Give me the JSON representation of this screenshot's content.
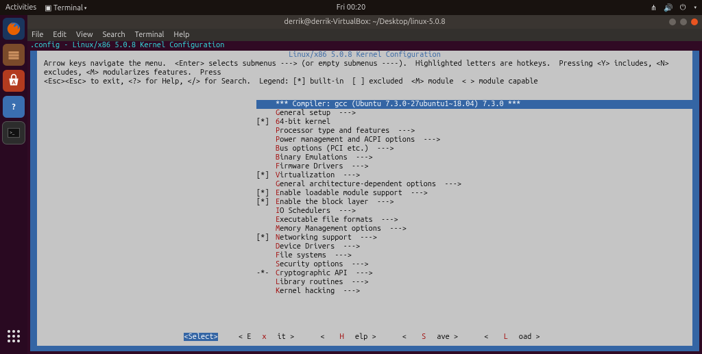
{
  "topbar": {
    "activities": "Activities",
    "app": "Terminal",
    "clock": "Fri 00:20"
  },
  "window": {
    "title": "derrik@derrik-VirtualBox: ~/Desktop/linux-5.0.8",
    "menubar": [
      "File",
      "Edit",
      "View",
      "Search",
      "Terminal",
      "Help"
    ]
  },
  "config_header": ".config - Linux/x86 5.0.8 Kernel Configuration",
  "box_title": "Linux/x86 5.0.8 Kernel Configuration",
  "help_line1": "Arrow keys navigate the menu.  <Enter> selects submenus ---> (or empty submenus ----).  Highlighted letters are hotkeys.  Pressing <Y> includes, <N> excludes, <M> modularizes features.  Press",
  "help_line2": "<Esc><Esc> to exit, <?> for Help, </> for Search.  Legend: [*] built-in  [ ] excluded  <M> module  < > module capable",
  "menu": [
    {
      "prefix": "   ",
      "hotkey": "",
      "text": "*** Compiler: gcc (Ubuntu 7.3.0-27ubuntu1~18.04) 7.3.0 ***",
      "selected": true
    },
    {
      "prefix": "   ",
      "hotkey": "G",
      "text": "eneral setup  --->"
    },
    {
      "prefix": "[*]",
      "hotkey": "6",
      "text": "4-bit kernel"
    },
    {
      "prefix": "   ",
      "hotkey": "P",
      "text": "rocessor type and features  --->"
    },
    {
      "prefix": "   ",
      "hotkey": "P",
      "text": "ower management and ACPI options  --->"
    },
    {
      "prefix": "   ",
      "hotkey": "B",
      "text": "us options (PCI etc.)  --->"
    },
    {
      "prefix": "   ",
      "hotkey": "B",
      "text": "inary Emulations  --->"
    },
    {
      "prefix": "   ",
      "hotkey": "F",
      "text": "irmware Drivers  --->"
    },
    {
      "prefix": "[*]",
      "hotkey": "V",
      "text": "irtualization  --->"
    },
    {
      "prefix": "   ",
      "hotkey": "G",
      "text": "eneral architecture-dependent options  --->"
    },
    {
      "prefix": "[*]",
      "hotkey": "E",
      "text": "nable loadable module support  --->"
    },
    {
      "prefix": "[*]",
      "hotkey": "E",
      "text": "nable the block layer  --->"
    },
    {
      "prefix": "   ",
      "hotkey": "I",
      "text": "O Schedulers  --->"
    },
    {
      "prefix": "   ",
      "hotkey": "E",
      "text": "xecutable file formats  --->"
    },
    {
      "prefix": "   ",
      "hotkey": "M",
      "text": "emory Management options  --->"
    },
    {
      "prefix": "[*]",
      "hotkey": "N",
      "text": "etworking support  --->"
    },
    {
      "prefix": "   ",
      "hotkey": "D",
      "text": "evice Drivers  --->"
    },
    {
      "prefix": "   ",
      "hotkey": "F",
      "text": "ile systems  --->"
    },
    {
      "prefix": "   ",
      "hotkey": "S",
      "text": "ecurity options  --->"
    },
    {
      "prefix": "-*-",
      "hotkey": "C",
      "text": "ryptographic API  --->"
    },
    {
      "prefix": "   ",
      "hotkey": "L",
      "text": "ibrary routines  --->"
    },
    {
      "prefix": "   ",
      "hotkey": "K",
      "text": "ernel hacking  --->"
    }
  ],
  "buttons": {
    "select": "<Select>",
    "exit_pre": "< E",
    "exit_hk": "x",
    "exit_post": "it >",
    "help_pre": "< ",
    "help_hk": "H",
    "help_post": "elp >",
    "save_pre": "< ",
    "save_hk": "S",
    "save_post": "ave >",
    "load_pre": "< ",
    "load_hk": "L",
    "load_post": "oad >"
  },
  "launcher_icons": [
    "firefox",
    "files",
    "software",
    "help",
    "terminal"
  ]
}
